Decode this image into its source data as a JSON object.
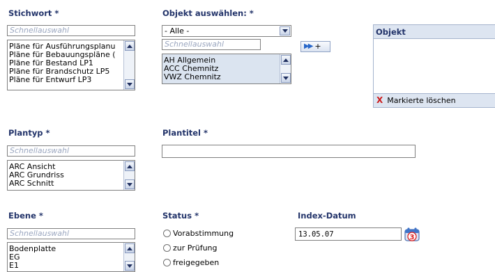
{
  "stichwort": {
    "label": "Stichwort *",
    "quick_placeholder": "Schnellauswahl",
    "items": [
      "Pläne für Ausführungsplanu",
      "Pläne für Bebauungspläne (",
      "Pläne für Bestand LP1",
      "Pläne für Brandschutz LP5",
      "Pläne für Entwurf LP3"
    ]
  },
  "objekt_auswahl": {
    "label": "Objekt auswählen: *",
    "dropdown_value": "- Alle -",
    "quick_placeholder": "Schnellauswahl",
    "add_label": "+",
    "items": [
      "AH Allgemein",
      "ACC Chemnitz",
      "VWZ Chemnitz"
    ]
  },
  "objekt_panel": {
    "header": "Objekt",
    "delete_label": "Markierte löschen"
  },
  "plantyp": {
    "label": "Plantyp *",
    "quick_placeholder": "Schnellauswahl",
    "items": [
      "ARC Ansicht",
      "ARC Grundriss",
      "ARC Schnitt"
    ]
  },
  "plantitel": {
    "label": "Plantitel *",
    "value": ""
  },
  "ebene": {
    "label": "Ebene *",
    "quick_placeholder": "Schnellauswahl",
    "items": [
      "Bodenplatte",
      "EG",
      "E1"
    ]
  },
  "status": {
    "label": "Status *",
    "options": [
      "Vorabstimmung",
      "zur Prüfung",
      "freigegeben"
    ]
  },
  "index_datum": {
    "label": "Index-Datum",
    "value": "13.05.07",
    "calendar_day": "3"
  }
}
